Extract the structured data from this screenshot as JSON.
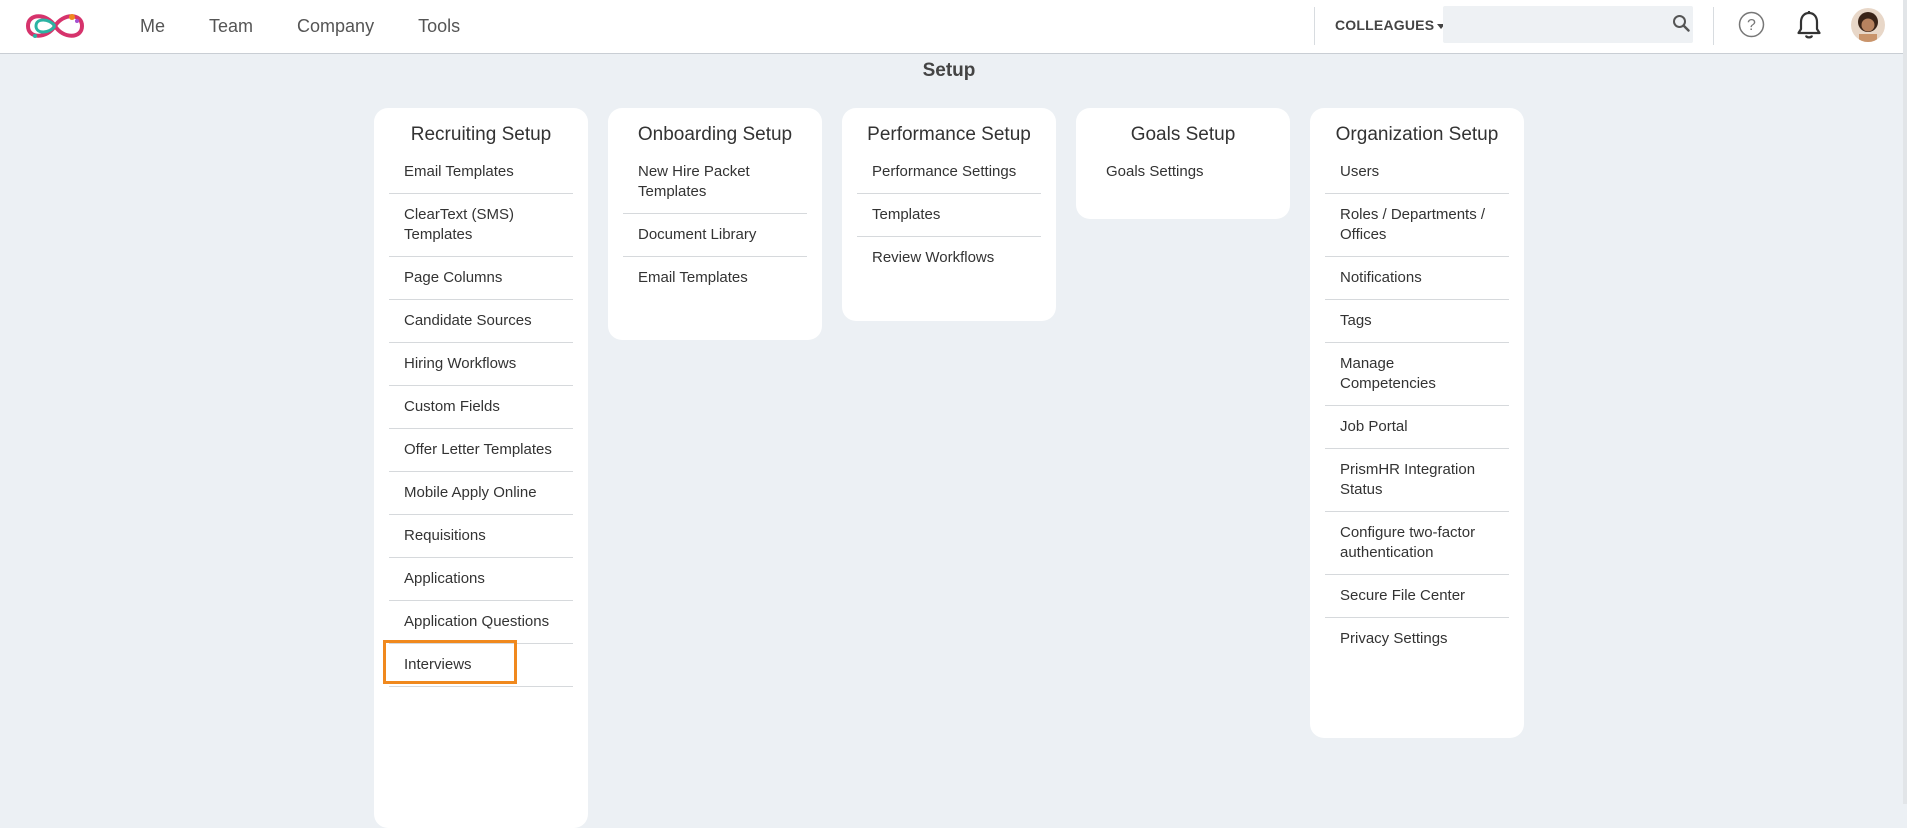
{
  "nav": {
    "items": [
      "Me",
      "Team",
      "Company",
      "Tools"
    ]
  },
  "header": {
    "colleagues_label": "COLLEAGUES",
    "search_value": "",
    "search_placeholder": ""
  },
  "page": {
    "title": "Setup"
  },
  "cards": [
    {
      "title": "Recruiting Setup",
      "links": [
        "Email Templates",
        "ClearText (SMS) Templates",
        "Page Columns",
        "Candidate Sources",
        "Hiring Workflows",
        "Custom Fields",
        "Offer Letter Templates",
        "Mobile Apply Online",
        "Requisitions",
        "Applications",
        "Application Questions",
        "Interviews"
      ]
    },
    {
      "title": "Onboarding Setup",
      "links": [
        "New Hire Packet Templates",
        "Document Library",
        "Email Templates"
      ]
    },
    {
      "title": "Performance Setup",
      "links": [
        "Performance Settings",
        "Templates",
        "Review Workflows"
      ]
    },
    {
      "title": "Goals Setup",
      "links": [
        "Goals Settings"
      ]
    },
    {
      "title": "Organization Setup",
      "links": [
        "Users",
        "Roles / Departments / Offices",
        "Notifications",
        "Tags",
        "Manage Competencies",
        "Job Portal",
        "PrismHR Integration Status",
        "Configure two-factor authentication",
        "Secure File Center",
        "Privacy Settings"
      ]
    }
  ],
  "colors": {
    "background": "#ecf0f4",
    "highlight": "#f0891e",
    "logo_pink": "#d6336c",
    "logo_teal": "#2bb3a3"
  },
  "icons": [
    "logo-icon",
    "search-icon",
    "help-icon",
    "bell-icon"
  ]
}
